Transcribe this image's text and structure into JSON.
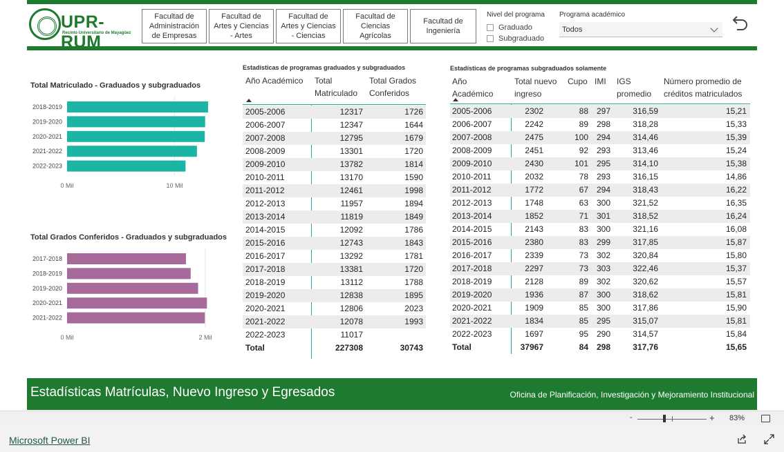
{
  "header": {
    "logo_text": "UPR-RUM",
    "logo_subtitle": "Recinto Universitario de Mayagüez",
    "faculty_buttons": [
      "Facultad de Administración de Empresas",
      "Facultad de Artes y Ciencias - Artes",
      "Facultad de Artes y Ciencias - Ciencias",
      "Facultad de Ciencias Agrícolas",
      "Facultad de Ingeniería"
    ],
    "nivel": {
      "title": "Nivel del programa",
      "options": [
        "Graduado",
        "Subgraduado"
      ]
    },
    "programa": {
      "title": "Programa académico",
      "selected": "Todos"
    }
  },
  "colors": {
    "brand_green": "#1e7a2e",
    "teal": "#1ab5a5",
    "mauve": "#a66b9a",
    "divider_teal": "#2aa79b"
  },
  "chart_data": [
    {
      "type": "bar",
      "orientation": "horizontal",
      "title": "Total Matriculado - Graduados y subgraduados",
      "categories": [
        "2018-2019",
        "2019-2020",
        "2020-2021",
        "2021-2022",
        "2022-2023"
      ],
      "values": [
        13112,
        12838,
        12806,
        12078,
        11017
      ],
      "xticks": [
        "0 Mil",
        "10 Mil"
      ],
      "xlim": [
        0,
        13500
      ],
      "color": "#1ab5a5"
    },
    {
      "type": "bar",
      "orientation": "horizontal",
      "title": "Total Grados Conferidos - Graduados y subgraduados",
      "categories": [
        "2017-2018",
        "2018-2019",
        "2019-2020",
        "2020-2021",
        "2021-2022"
      ],
      "values": [
        1720,
        1788,
        1895,
        2023,
        1993
      ],
      "xticks": [
        "0 Mil",
        "2 Mil"
      ],
      "xlim": [
        0,
        2100
      ],
      "color": "#a66b9a"
    }
  ],
  "table1": {
    "title": "Estadísticas de programas graduados y subgraduados",
    "headers": [
      "Año Académico",
      "Total Matriculado",
      "Total Grados Conferidos"
    ],
    "rows": [
      [
        "2005-2006",
        "12317",
        "1726"
      ],
      [
        "2006-2007",
        "12347",
        "1644"
      ],
      [
        "2007-2008",
        "12795",
        "1679"
      ],
      [
        "2008-2009",
        "13301",
        "1720"
      ],
      [
        "2009-2010",
        "13782",
        "1814"
      ],
      [
        "2010-2011",
        "13170",
        "1590"
      ],
      [
        "2011-2012",
        "12461",
        "1998"
      ],
      [
        "2012-2013",
        "11957",
        "1894"
      ],
      [
        "2013-2014",
        "11819",
        "1849"
      ],
      [
        "2014-2015",
        "12092",
        "1786"
      ],
      [
        "2015-2016",
        "12743",
        "1843"
      ],
      [
        "2016-2017",
        "13292",
        "1781"
      ],
      [
        "2017-2018",
        "13381",
        "1720"
      ],
      [
        "2018-2019",
        "13112",
        "1788"
      ],
      [
        "2019-2020",
        "12838",
        "1895"
      ],
      [
        "2020-2021",
        "12806",
        "2023"
      ],
      [
        "2021-2022",
        "12078",
        "1993"
      ],
      [
        "2022-2023",
        "11017",
        ""
      ]
    ],
    "total": [
      "Total",
      "227308",
      "30743"
    ]
  },
  "table2": {
    "title": "Estadísticas de programas subgraduados solamente",
    "headers": [
      "Año Académico",
      "Total nuevo ingreso",
      "Cupo",
      "IMI",
      "IGS promedio",
      "Número promedio de créditos matriculados"
    ],
    "rows": [
      [
        "2005-2006",
        "2302",
        "88",
        "297",
        "316,59",
        "15,21"
      ],
      [
        "2006-2007",
        "2242",
        "89",
        "298",
        "318,28",
        "15,33"
      ],
      [
        "2007-2008",
        "2475",
        "100",
        "294",
        "314,46",
        "15,39"
      ],
      [
        "2008-2009",
        "2451",
        "92",
        "293",
        "313,46",
        "15,24"
      ],
      [
        "2009-2010",
        "2430",
        "101",
        "295",
        "314,10",
        "15,38"
      ],
      [
        "2010-2011",
        "2032",
        "78",
        "293",
        "316,15",
        "14,86"
      ],
      [
        "2011-2012",
        "1772",
        "67",
        "294",
        "318,43",
        "16,22"
      ],
      [
        "2012-2013",
        "1748",
        "63",
        "300",
        "321,52",
        "16,35"
      ],
      [
        "2013-2014",
        "1852",
        "71",
        "301",
        "318,52",
        "16,24"
      ],
      [
        "2014-2015",
        "2143",
        "83",
        "300",
        "321,16",
        "16,08"
      ],
      [
        "2015-2016",
        "2380",
        "83",
        "299",
        "317,85",
        "15,87"
      ],
      [
        "2016-2017",
        "2339",
        "73",
        "302",
        "320,84",
        "15,80"
      ],
      [
        "2017-2018",
        "2297",
        "73",
        "303",
        "322,46",
        "15,37"
      ],
      [
        "2018-2019",
        "2128",
        "89",
        "302",
        "320,62",
        "15,57"
      ],
      [
        "2019-2020",
        "1936",
        "87",
        "300",
        "318,62",
        "15,81"
      ],
      [
        "2020-2021",
        "1909",
        "85",
        "300",
        "317,86",
        "15,90"
      ],
      [
        "2021-2022",
        "1834",
        "85",
        "295",
        "315,07",
        "15,81"
      ],
      [
        "2022-2023",
        "1697",
        "95",
        "290",
        "314,57",
        "15,84"
      ]
    ],
    "total": [
      "Total",
      "37967",
      "84",
      "298",
      "317,76",
      "15,65"
    ]
  },
  "footer": {
    "title": "Estadísticas Matrículas, Nuevo Ingreso y Egresados",
    "office": "Oficina de Planificación, Investigación y Mejoramiento Institucional"
  },
  "zoom": {
    "minus": "-",
    "plus": "+",
    "percent": "83%"
  },
  "powerbi": {
    "link": "Microsoft Power BI"
  }
}
